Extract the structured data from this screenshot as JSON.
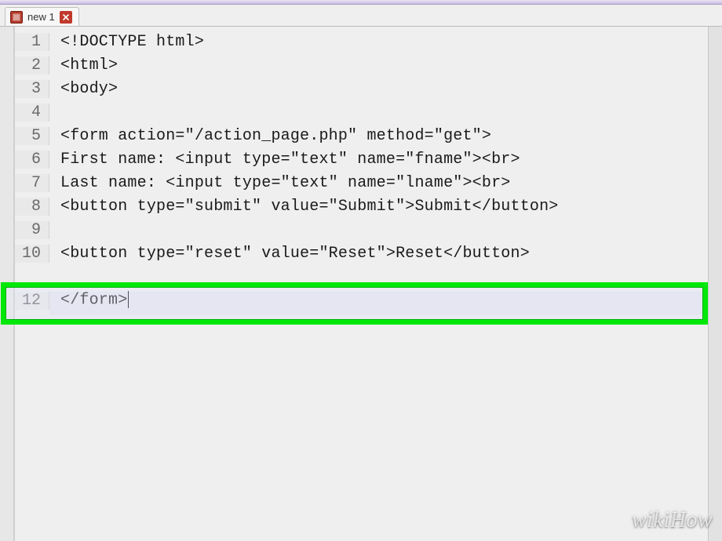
{
  "tab": {
    "label": "new 1"
  },
  "gutter": [
    "1",
    "2",
    "3",
    "4",
    "5",
    "6",
    "7",
    "8",
    "9",
    "10",
    "",
    "12"
  ],
  "code_lines": [
    "<!DOCTYPE html>",
    "<html>",
    "<body>",
    "",
    "<form action=\"/action_page.php\" method=\"get\">",
    "First name: <input type=\"text\" name=\"fname\"><br>",
    "Last name: <input type=\"text\" name=\"lname\"><br>",
    "<button type=\"submit\" value=\"Submit\">Submit</button>",
    "",
    "<button type=\"reset\" value=\"Reset\">Reset</button>",
    "",
    "</form>"
  ],
  "cursor_line_index": 11,
  "highlight_line_index": 11,
  "watermark": "wikiHow"
}
